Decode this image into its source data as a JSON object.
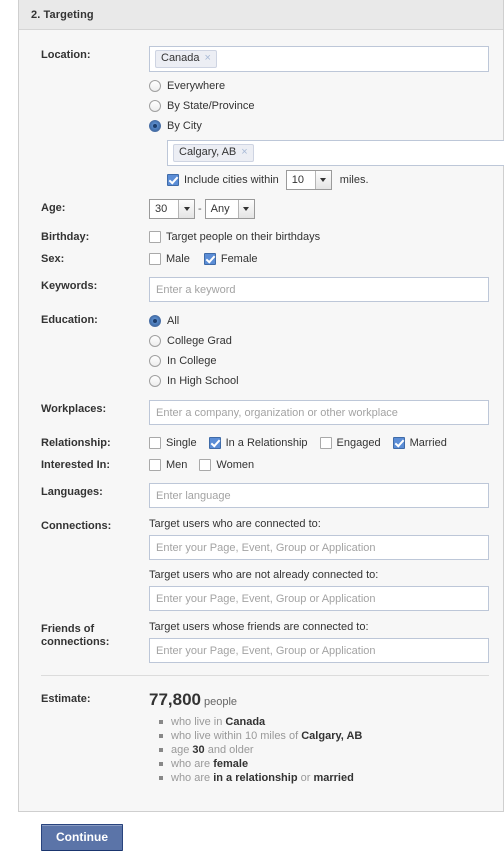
{
  "panel": {
    "header_title": "2. Targeting"
  },
  "form": {
    "location": {
      "label": "Location:",
      "country_token": "Canada",
      "token_remove_icon": "×",
      "scope_options": [
        {
          "label": "Everywhere",
          "selected": false
        },
        {
          "label": "By State/Province",
          "selected": false
        },
        {
          "label": "By City",
          "selected": true
        }
      ],
      "city_token": "Calgary, AB",
      "include_cities_checkbox": {
        "label": "Include cities within",
        "checked": true
      },
      "radius_value": "10",
      "radius_suffix": "miles."
    },
    "age": {
      "label": "Age:",
      "min_value": "30",
      "separator": "-",
      "max_value": "Any"
    },
    "birthday": {
      "label": "Birthday:",
      "checkbox": {
        "label": "Target people on their birthdays",
        "checked": false
      }
    },
    "sex": {
      "label": "Sex:",
      "options": [
        {
          "label": "Male",
          "checked": false
        },
        {
          "label": "Female",
          "checked": true
        }
      ]
    },
    "keywords": {
      "label": "Keywords:",
      "value": "",
      "placeholder": "Enter a keyword"
    },
    "education": {
      "label": "Education:",
      "options": [
        {
          "label": "All",
          "selected": true
        },
        {
          "label": "College Grad",
          "selected": false
        },
        {
          "label": "In College",
          "selected": false
        },
        {
          "label": "In High School",
          "selected": false
        }
      ]
    },
    "workplaces": {
      "label": "Workplaces:",
      "value": "",
      "placeholder": "Enter a company, organization or other workplace"
    },
    "relationship": {
      "label": "Relationship:",
      "options": [
        {
          "label": "Single",
          "checked": false
        },
        {
          "label": "In a Relationship",
          "checked": true
        },
        {
          "label": "Engaged",
          "checked": false
        },
        {
          "label": "Married",
          "checked": true
        }
      ]
    },
    "interested_in": {
      "label": "Interested In:",
      "options": [
        {
          "label": "Men",
          "checked": false
        },
        {
          "label": "Women",
          "checked": false
        }
      ]
    },
    "languages": {
      "label": "Languages:",
      "value": "",
      "placeholder": "Enter language"
    },
    "connections": {
      "label": "Connections:",
      "connected_caption": "Target users who are connected to:",
      "connected_placeholder": "Enter your Page, Event, Group or Application",
      "connected_value": "",
      "not_connected_caption": "Target users who are not already connected to:",
      "not_connected_placeholder": "Enter your Page, Event, Group or Application",
      "not_connected_value": ""
    },
    "friends_of_connections": {
      "label_line1": "Friends of",
      "label_line2": "connections:",
      "caption": "Target users whose friends are connected to:",
      "placeholder": "Enter your Page, Event, Group or Application",
      "value": ""
    }
  },
  "estimate": {
    "label": "Estimate:",
    "count": "77,800",
    "unit": "people",
    "criteria": [
      {
        "prefix": "who live in ",
        "strong": "Canada",
        "suffix": ""
      },
      {
        "prefix": "who live within 10 miles of ",
        "strong": "Calgary, AB",
        "suffix": ""
      },
      {
        "prefix": "age ",
        "strong": "30",
        "suffix": " and older"
      },
      {
        "prefix": "who are ",
        "strong": "female",
        "suffix": ""
      },
      {
        "prefix": "who are ",
        "strong": "in a relationship",
        "suffix": " or ",
        "strong2": "married"
      }
    ]
  },
  "footer": {
    "continue_label": "Continue"
  },
  "colors": {
    "accent_blue": "#5b74a8",
    "checkbox_blue": "#5b8dd6",
    "panel_bg": "#f7f7f7",
    "header_bg": "#e9e9e9",
    "input_border": "#bdc7d8"
  }
}
